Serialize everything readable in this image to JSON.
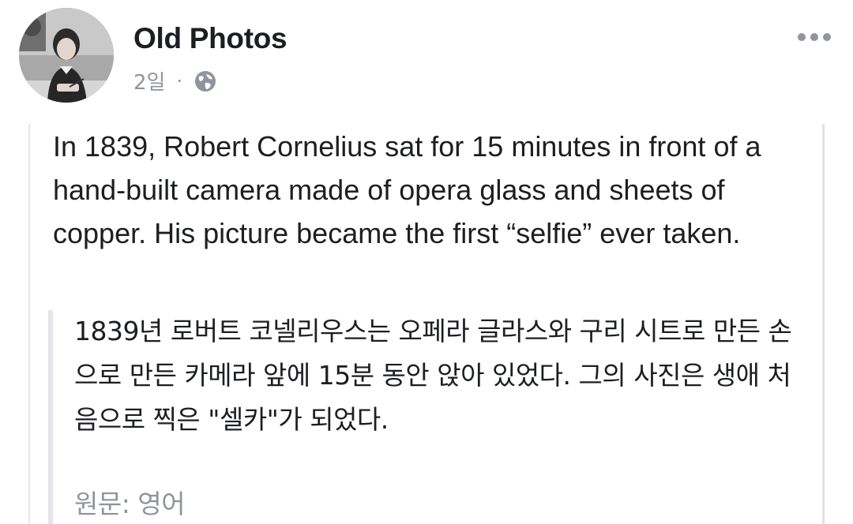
{
  "post": {
    "page_name": "Old Photos",
    "timestamp": "2일",
    "separator": "·",
    "privacy_icon": "globe-icon",
    "more_icon": "more-options-icon",
    "avatar": "profile-photo-girl-writing",
    "text": "In 1839, Robert Cornelius sat for 15 minutes in front of a hand-built camera made of opera glass and sheets of copper. His picture became the first “selfie” ever taken.",
    "translation": "1839년 로버트 코넬리우스는 오페라 글라스와 구리 시트로 만든 손으로 만든 카메라 앞에 15분 동안 앉아 있었다. 그의 사진은 생애 처음으로 찍은 \"셀카\"가 되었다.",
    "original_language": "원문: 영어"
  },
  "colors": {
    "text": "#1c1e21",
    "secondary": "#90949c",
    "divider": "#e4e6eb"
  }
}
